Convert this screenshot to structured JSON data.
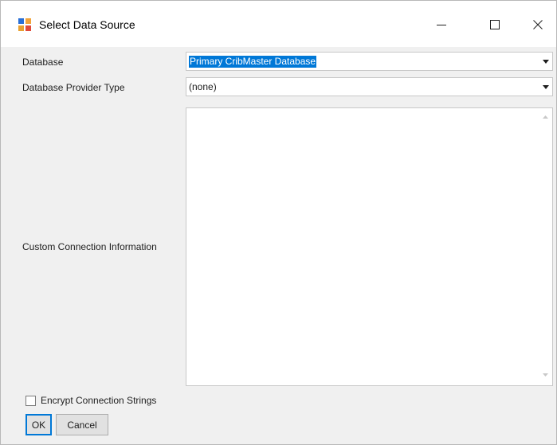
{
  "window": {
    "title": "Select Data Source",
    "controls": [
      "minimize-icon",
      "maximize-icon",
      "close-icon"
    ]
  },
  "form": {
    "database_label": "Database",
    "database_value": "Primary CribMaster Database",
    "provider_label": "Database Provider Type",
    "provider_value": "(none)",
    "custom_label": "Custom Connection Information",
    "custom_value": "",
    "encrypt_label": "Encrypt Connection Strings",
    "encrypt_checked": false
  },
  "buttons": {
    "ok_label": "OK",
    "cancel_label": "Cancel"
  },
  "colors": {
    "accent": "#0078d7",
    "background": "#f0f0f0"
  }
}
